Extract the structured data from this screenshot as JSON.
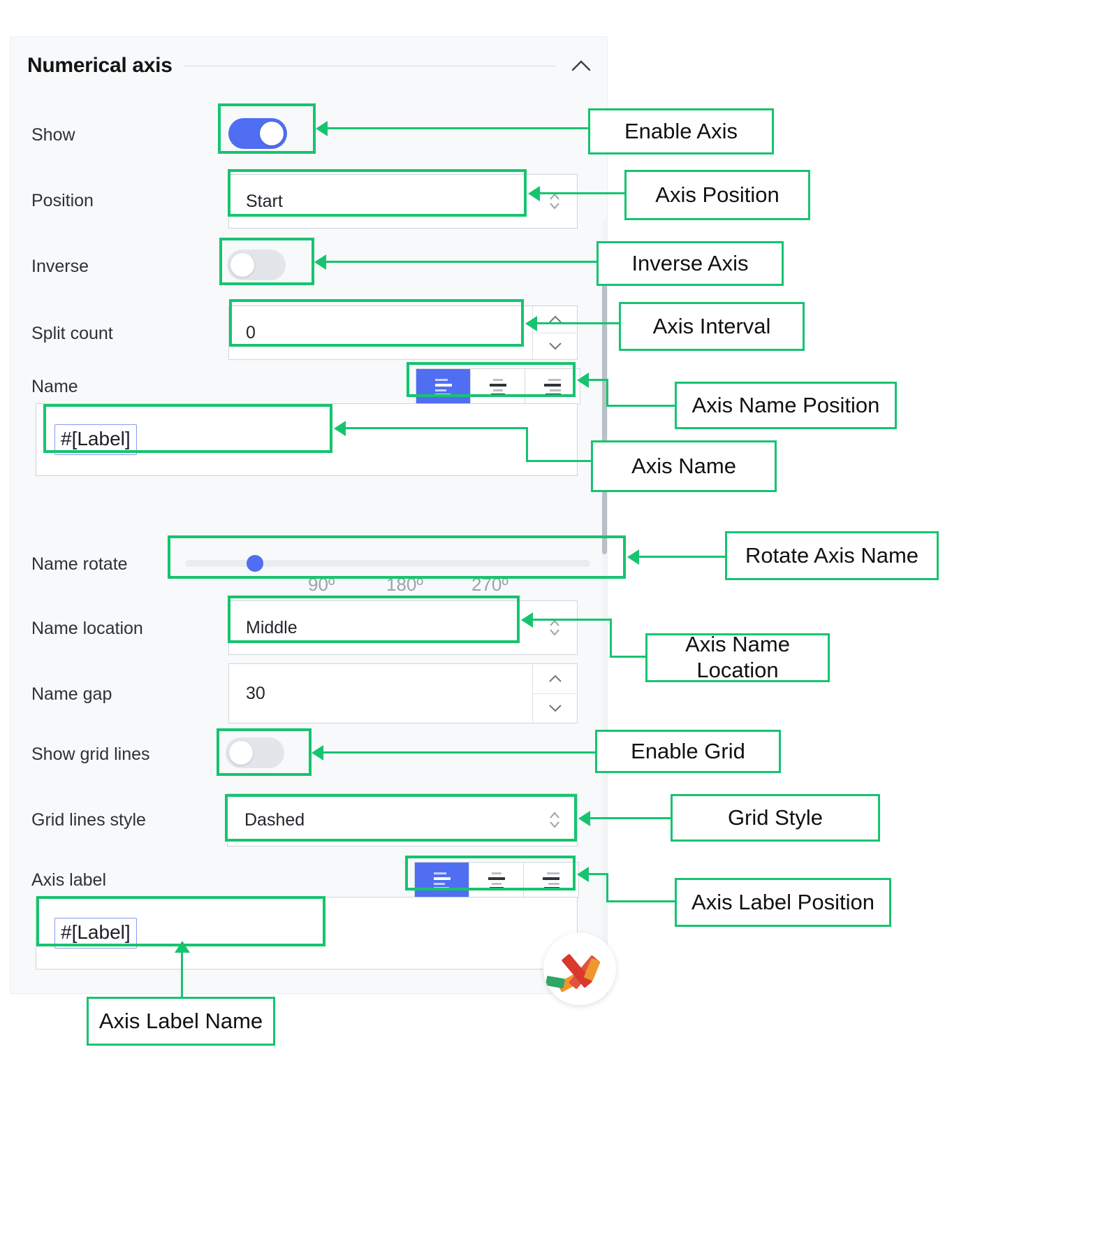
{
  "panel": {
    "section_title": "Numerical axis",
    "collapse_icon": "chevron-up-icon",
    "rows": {
      "show": {
        "label": "Show",
        "toggle_state": "on"
      },
      "position": {
        "label": "Position",
        "value": "Start",
        "control": "stepper-select"
      },
      "inverse": {
        "label": "Inverse",
        "toggle_state": "off"
      },
      "split_count": {
        "label": "Split count",
        "value": "0",
        "control": "number-spinner"
      },
      "name": {
        "label": "Name",
        "token": "#[Label]",
        "align_selected": 0
      },
      "name_rotate": {
        "label": "Name rotate",
        "ticks": [
          "90º",
          "180º",
          "270º"
        ],
        "knob_percent": 12
      },
      "name_location": {
        "label": "Name location",
        "value": "Middle",
        "control": "stepper-select"
      },
      "name_gap": {
        "label": "Name gap",
        "value": "30",
        "control": "number-spinner"
      },
      "show_grid_lines": {
        "label": "Show grid lines",
        "toggle_state": "off"
      },
      "grid_lines_style": {
        "label": "Grid lines style",
        "value": "Dashed",
        "control": "stepper-select"
      },
      "axis_label": {
        "label": "Axis label",
        "token": "#[Label]",
        "align_selected": 0
      }
    },
    "align_options": [
      "align-left-icon",
      "align-center-icon",
      "align-right-icon"
    ]
  },
  "annotations": [
    {
      "id": "enable-axis",
      "text": "Enable Axis"
    },
    {
      "id": "axis-position",
      "text": "Axis Position"
    },
    {
      "id": "inverse-axis",
      "text": "Inverse Axis"
    },
    {
      "id": "axis-interval",
      "text": "Axis Interval"
    },
    {
      "id": "axis-name-position",
      "text": "Axis Name Position"
    },
    {
      "id": "axis-name",
      "text": "Axis Name"
    },
    {
      "id": "rotate-axis-name",
      "text": "Rotate Axis Name"
    },
    {
      "id": "axis-name-location",
      "text": "Axis Name\nLocation"
    },
    {
      "id": "enable-grid",
      "text": "Enable Grid"
    },
    {
      "id": "grid-style",
      "text": "Grid Style"
    },
    {
      "id": "axis-label-position",
      "text": "Axis Label Position"
    },
    {
      "id": "axis-label-name",
      "text": "Axis Label Name"
    }
  ],
  "colors": {
    "accent_blue": "#4f6ef2",
    "annotation_green": "#16c46f",
    "panel_background": "#f7f9fb",
    "text_primary": "#22262b"
  }
}
